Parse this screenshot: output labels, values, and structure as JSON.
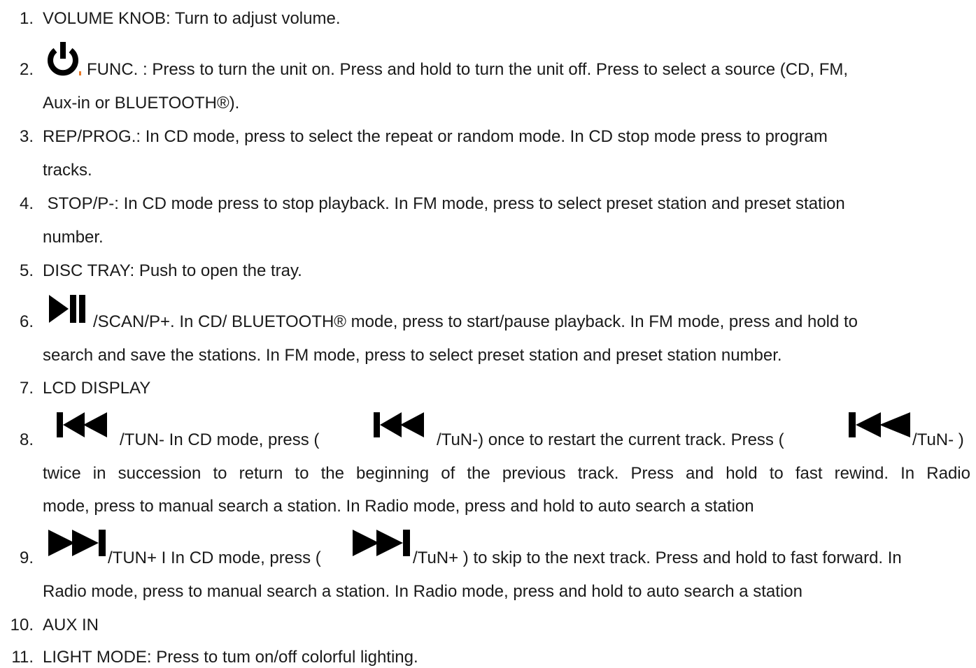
{
  "items": [
    {
      "number": "1.",
      "lines": [
        "VOLUME KNOB: Turn to adjust volume."
      ]
    },
    {
      "number": "2.",
      "icon": "power-icon",
      "lines": [
        "FUNC. : Press to turn the unit on. Press and hold to turn the unit off. Press to select a source (CD, FM,",
        "Aux-in or BLUETOOTH®)."
      ]
    },
    {
      "number": "3.",
      "lines": [
        "REP/PROG.: In CD mode, press to select the repeat or random mode. In CD stop mode press to program",
        "tracks."
      ]
    },
    {
      "number": "4.",
      "lines": [
        " STOP/P-: In CD mode press to stop playback. In FM mode, press to select preset station and preset station",
        "number."
      ]
    },
    {
      "number": "5.",
      "lines": [
        "DISC TRAY: Push to open the tray."
      ]
    },
    {
      "number": "6.",
      "icon": "play-pause-icon",
      "lines": [
        "/SCAN/P+. In CD/ BLUETOOTH® mode, press to start/pause playback. In FM mode, press and hold to",
        "search and save the stations. In FM mode, press to select preset station and preset station number."
      ]
    },
    {
      "number": "7.",
      "lines": [
        "LCD DISPLAY"
      ]
    },
    {
      "number": "8.",
      "icon": "previous-track-icon",
      "parts": [
        "/TUN- In CD mode, press (",
        "/TuN-) once to restart the current track. Press (",
        "/TuN- )"
      ],
      "lines": [
        "twice in succession to return to the beginning of the previous track. Press and hold to fast rewind. In Radio",
        "mode, press to manual search a station. In Radio mode, press and hold to auto search a station"
      ]
    },
    {
      "number": "9.",
      "icon": "next-track-icon",
      "parts": [
        "/TUN+ I In CD mode, press (",
        "/TuN+ ) to skip to the next track. Press and hold to fast forward. In"
      ],
      "lines": [
        "Radio mode, press to manual search a station. In Radio mode, press and hold to auto search a station"
      ]
    },
    {
      "number": "10.",
      "lines": [
        "AUX IN"
      ]
    },
    {
      "number": "11.",
      "lines": [
        "LIGHT MODE: Press to tum on/off colorful lighting."
      ]
    }
  ]
}
